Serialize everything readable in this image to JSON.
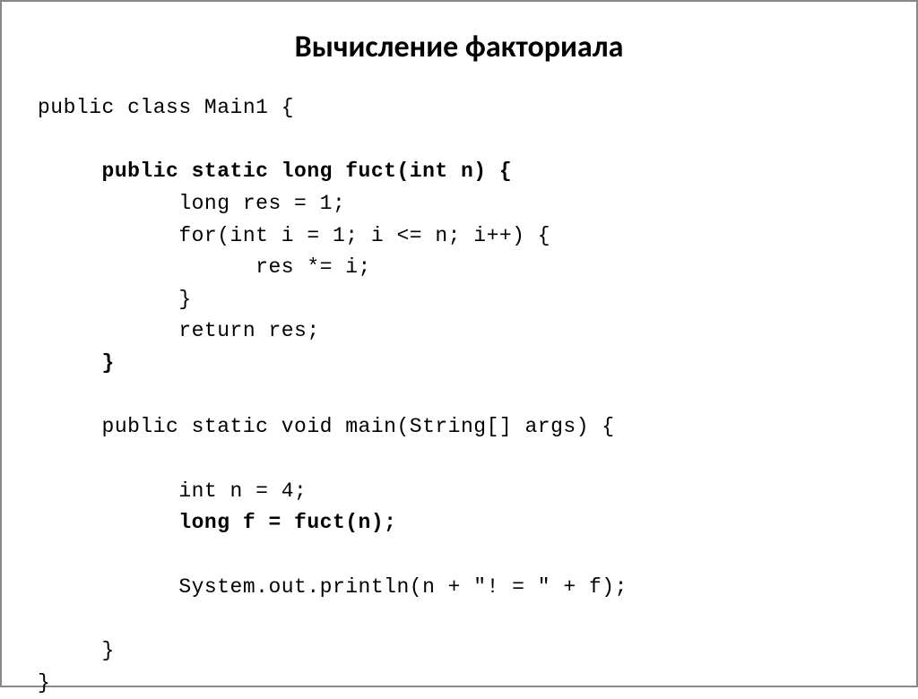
{
  "title": "Вычисление факториала",
  "code": {
    "l1": "public class Main1 {",
    "l2": "",
    "l3": "     public static long fuct(int n) {",
    "l4": "           long res = 1;",
    "l5": "           for(int i = 1; i <= n; i++) {",
    "l6": "                 res *= i;",
    "l7": "           }",
    "l8": "           return res;",
    "l9": "     }",
    "l10": "",
    "l11": "     public static void main(String[] args) {",
    "l12": "",
    "l13": "           int n = 4;",
    "l14": "           long f = fuct(n);",
    "l15": "",
    "l16": "           System.out.println(n + \"! = \" + f);",
    "l17": "",
    "l18": "     }",
    "l19": "}"
  }
}
